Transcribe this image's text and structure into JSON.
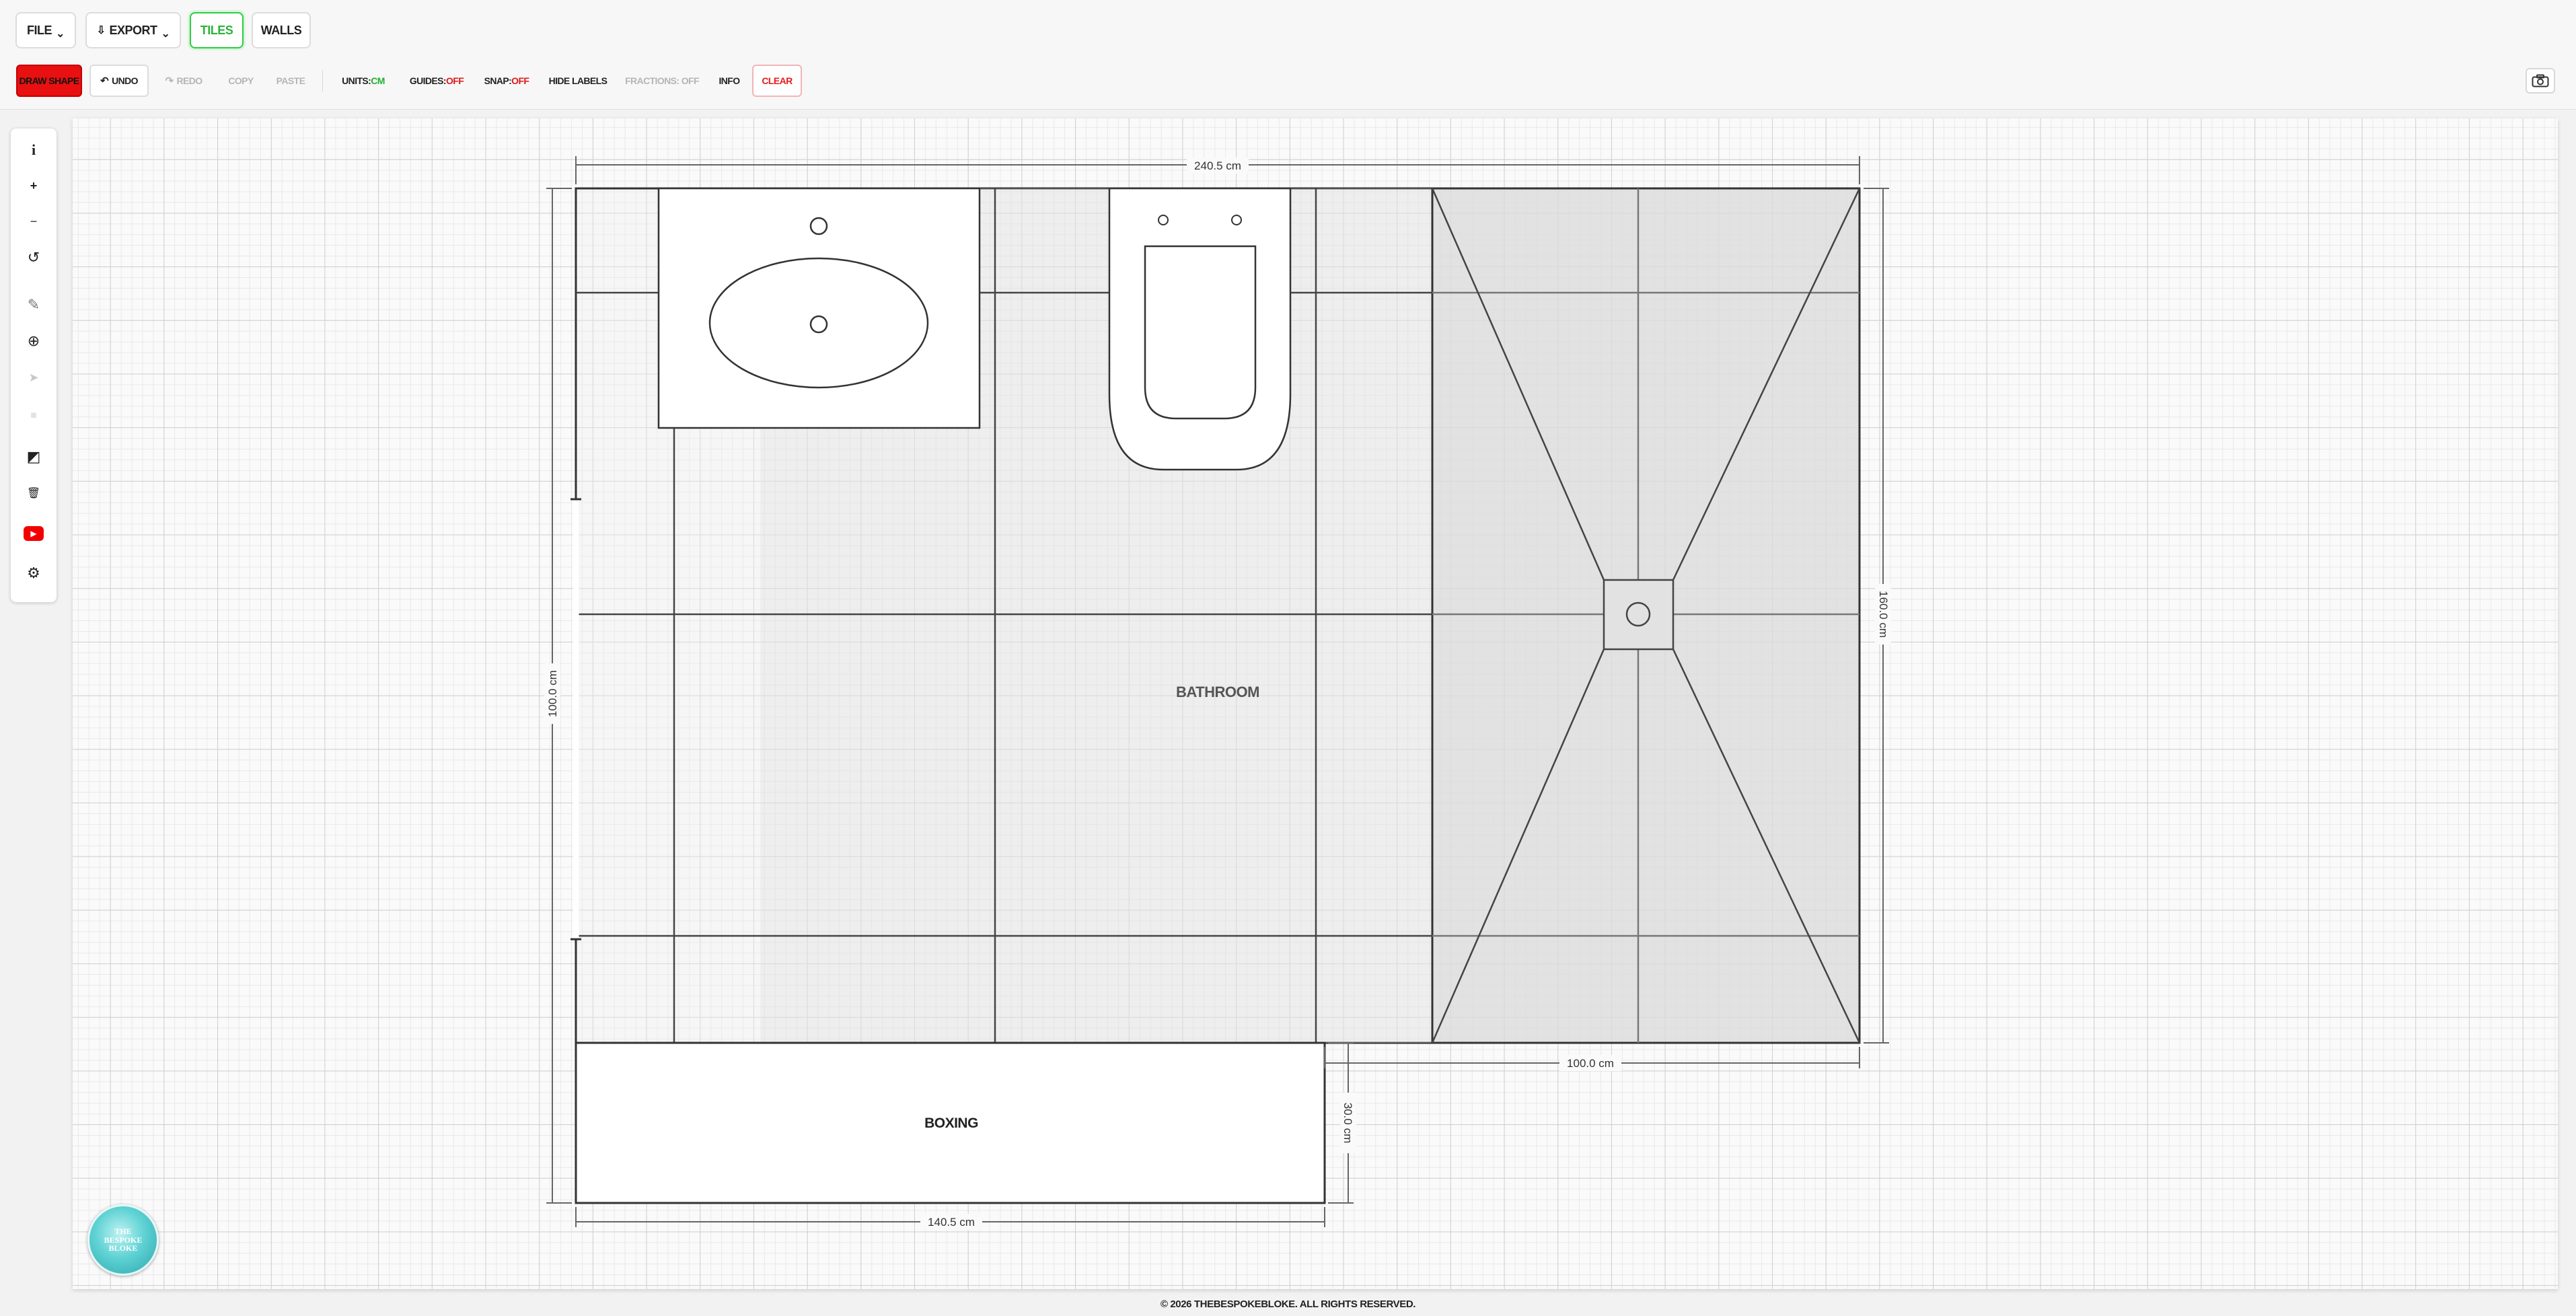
{
  "menu": {
    "file_label": "FILE",
    "export_label": "EXPORT",
    "tiles_label": "TILES",
    "walls_label": "WALLS"
  },
  "toolbar": {
    "draw_shape": "DRAW SHAPE",
    "undo": "UNDO",
    "redo": "REDO",
    "copy": "COPY",
    "paste": "PASTE",
    "units_label": "UNITS:",
    "units_value": "CM",
    "guides_label": "GUIDES:",
    "guides_value": "OFF",
    "snap_label": "SNAP:",
    "snap_value": "OFF",
    "hide_labels": "HIDE LABELS",
    "fractions": "FRACTIONS: OFF",
    "info": "INFO",
    "clear": "CLEAR"
  },
  "side_tools": [
    {
      "icon": "info-icon",
      "glyph": "i"
    },
    {
      "icon": "zoom-in-icon",
      "glyph": "+"
    },
    {
      "icon": "zoom-out-icon",
      "glyph": "−"
    },
    {
      "icon": "rotate-icon",
      "glyph": "↺"
    },
    {
      "icon": "measure-icon",
      "glyph": "✎"
    },
    {
      "icon": "crosshair-icon",
      "glyph": "⊕"
    },
    {
      "icon": "arrow-icon",
      "glyph": "➤"
    },
    {
      "icon": "square-icon",
      "glyph": "■"
    },
    {
      "icon": "shape-edit-icon",
      "glyph": "◩"
    },
    {
      "icon": "delete-icon",
      "glyph": "🗑"
    },
    {
      "icon": "youtube-icon",
      "glyph": "▶"
    },
    {
      "icon": "settings-icon",
      "glyph": "⚙"
    }
  ],
  "plan": {
    "room_label": "BATHROOM",
    "boxing_label": "BOXING",
    "dim_top": "240.5 cm",
    "dim_right": "160.0 cm",
    "dim_left": "100.0 cm",
    "dim_shower": "100.0 cm",
    "dim_boxing_depth": "30.0 cm",
    "dim_boxing_width": "140.5 cm"
  },
  "footer": {
    "copyright": "© 2026 THEBESPOKEBLOKE. ALL RIGHTS RESERVED."
  },
  "logo": {
    "text": "THE BESPOKE BLOKE"
  },
  "colors": {
    "accent_green": "#2ecc40",
    "draw_red": "#e81010",
    "clear_red": "#e51c1c"
  }
}
